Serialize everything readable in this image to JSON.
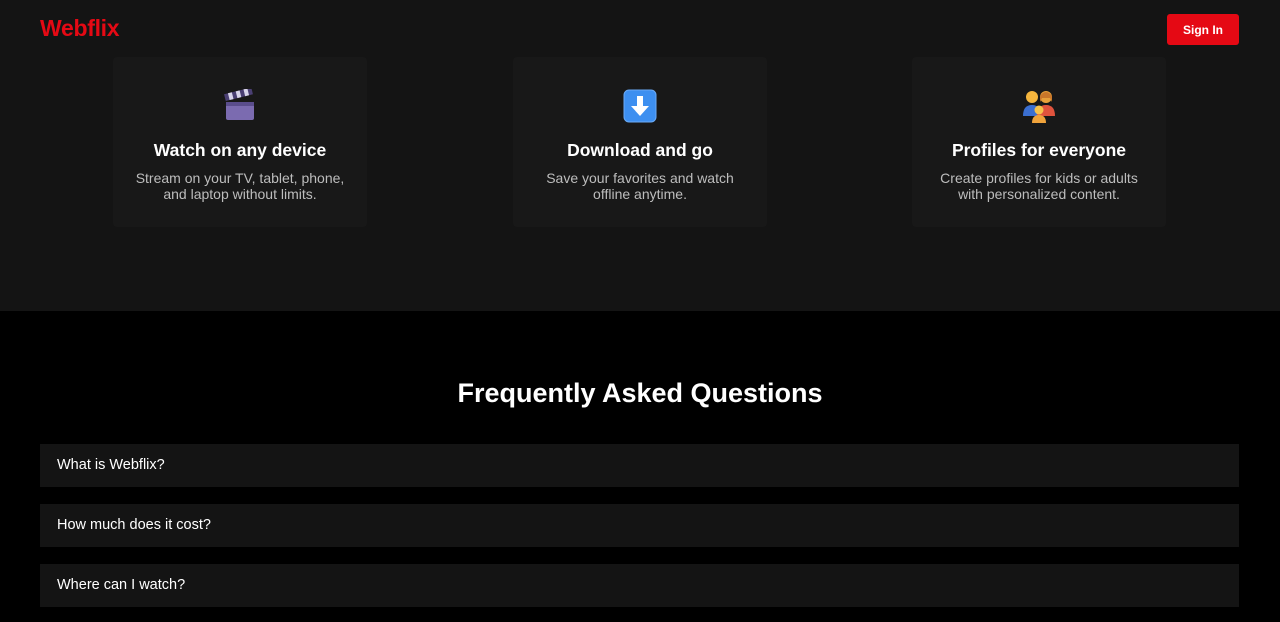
{
  "header": {
    "logo": "Webflix",
    "signin_label": "Sign In"
  },
  "colors": {
    "brand": "#e50914",
    "features_bg": "#141414",
    "card_bg": "#181818",
    "faq_bg": "#000000",
    "faq_item_bg": "#141414"
  },
  "features": [
    {
      "icon": "clapper-board-icon",
      "title": "Watch on any device",
      "description": "Stream on your TV, tablet, phone, and laptop without limits."
    },
    {
      "icon": "download-arrow-icon",
      "title": "Download and go",
      "description": "Save your favorites and watch offline anytime."
    },
    {
      "icon": "family-profiles-icon",
      "title": "Profiles for everyone",
      "description": "Create profiles for kids or adults with personalized content."
    }
  ],
  "faq": {
    "title": "Frequently Asked Questions",
    "items": [
      {
        "question": "What is Webflix?"
      },
      {
        "question": "How much does it cost?"
      },
      {
        "question": "Where can I watch?"
      }
    ]
  }
}
